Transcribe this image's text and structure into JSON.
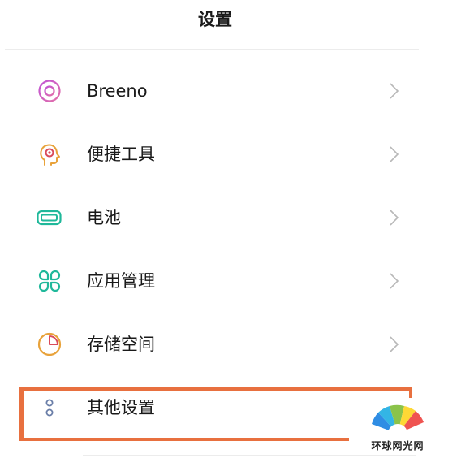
{
  "header": {
    "title": "设置"
  },
  "menu": {
    "items": [
      {
        "label": "Breeno",
        "icon": "breeno-icon",
        "color": "#a35bd6"
      },
      {
        "label": "便捷工具",
        "icon": "convenience-tools-icon",
        "color": "#e8a23a"
      },
      {
        "label": "电池",
        "icon": "battery-icon",
        "color": "#1fb89a"
      },
      {
        "label": "应用管理",
        "icon": "app-management-icon",
        "color": "#1fb89a"
      },
      {
        "label": "存储空间",
        "icon": "storage-icon",
        "color": "#e8a23a"
      },
      {
        "label": "其他设置",
        "icon": "other-settings-icon",
        "color": "#6a7ea8"
      }
    ]
  },
  "highlight": {
    "color": "#e8703f"
  },
  "watermark": {
    "text": "环球网光网"
  }
}
